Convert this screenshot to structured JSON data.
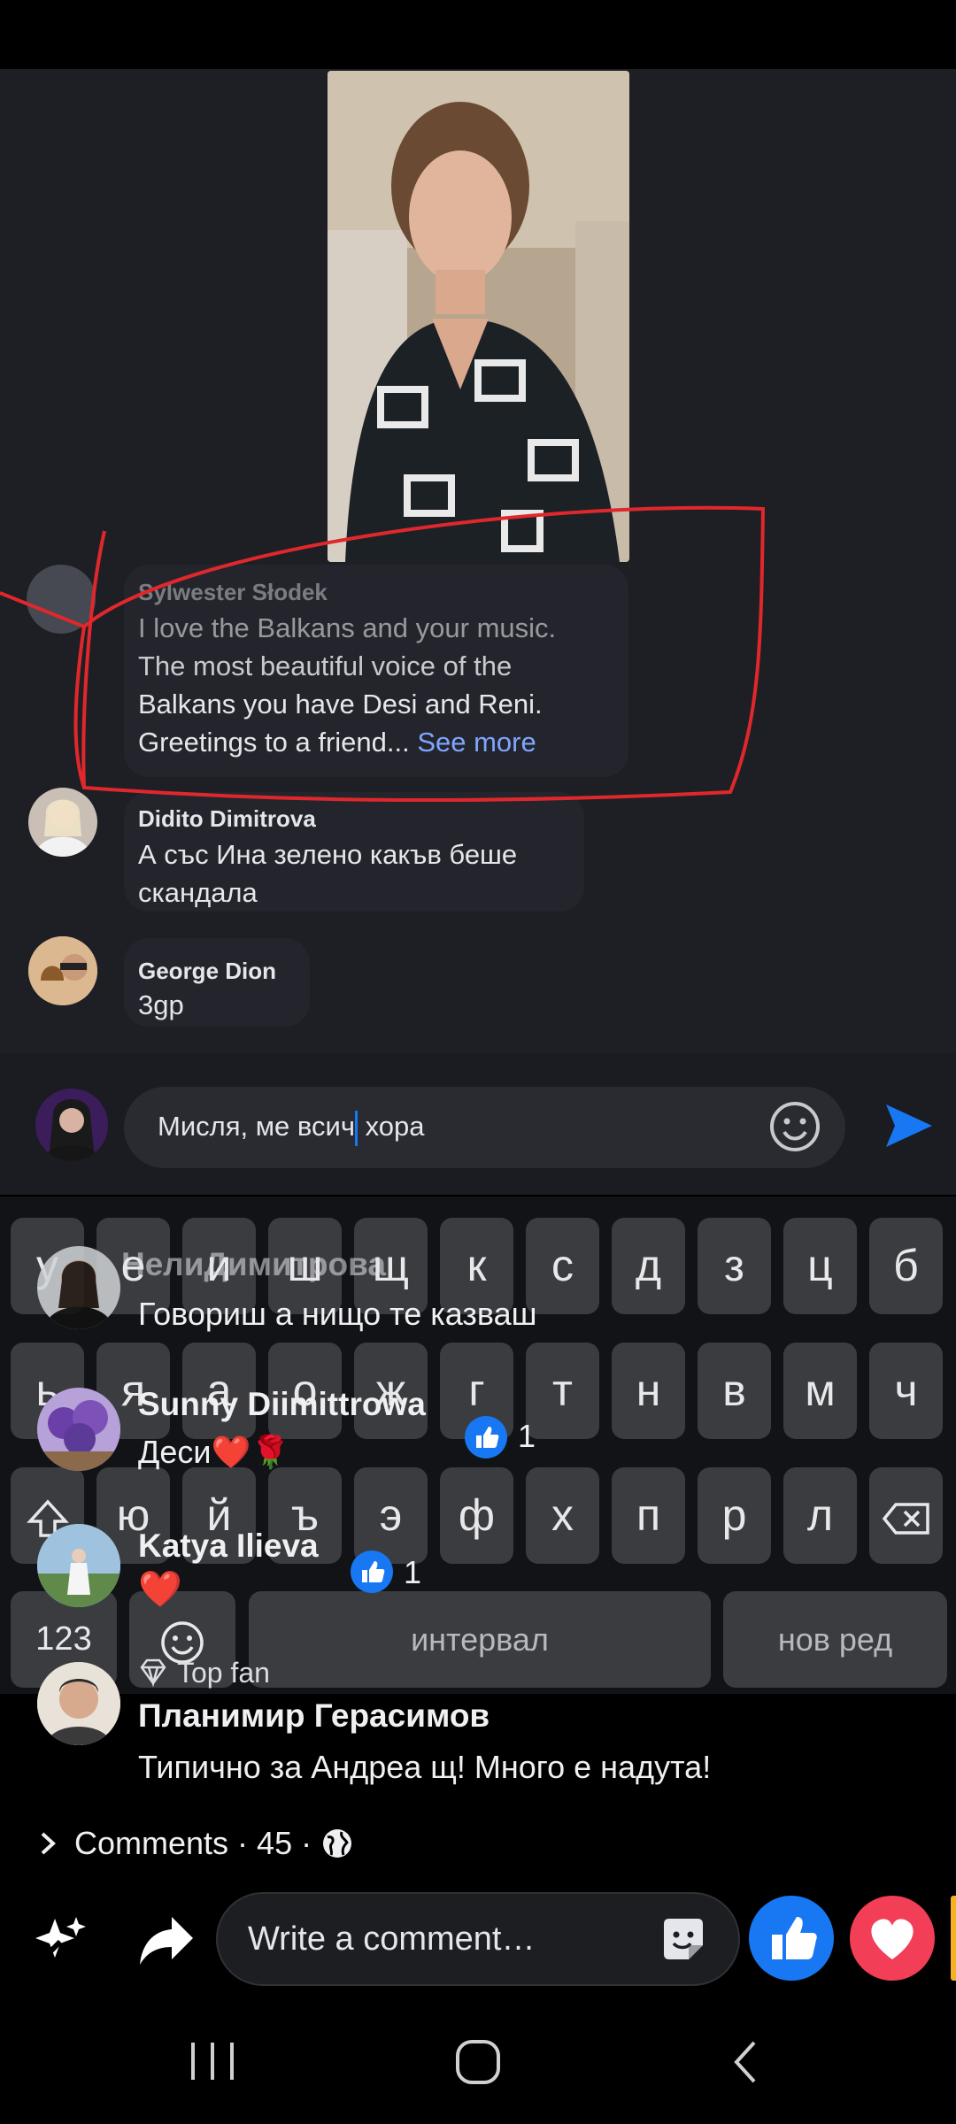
{
  "video": {
    "alt": "Live video of woman singing"
  },
  "comments": [
    {
      "name": "Sylwester Słodek",
      "text_lines": [
        "I love the Balkans and your music.",
        "The most beautiful voice of the",
        "Balkans you have Desi and Reni.",
        "Greetings to a friend... "
      ],
      "see_more": "See more"
    },
    {
      "name": "Didito Dimitrova",
      "text_lines": [
        "А със Ина зелено какъв беше",
        "скандала"
      ]
    },
    {
      "name": "George Dion",
      "text_lines": [
        "3gp"
      ]
    }
  ],
  "composer": {
    "value_before_cursor": "Мисля, ме всич",
    "value_after_cursor": " хора"
  },
  "keyboard": {
    "row1": [
      "у",
      "е",
      "и",
      "ш",
      "щ",
      "к",
      "с",
      "д",
      "з",
      "ц",
      "б"
    ],
    "row2": [
      "ь",
      "я",
      "а",
      "о",
      "ж",
      "г",
      "т",
      "н",
      "в",
      "м",
      "ч"
    ],
    "row3": [
      "ю",
      "й",
      "ъ",
      "э",
      "ф",
      "х",
      "п",
      "р",
      "л"
    ],
    "num_label": "123",
    "space_label": "интервал",
    "enter_label": "нов ред"
  },
  "overlay_comments": [
    {
      "name": "НелиДимитрова",
      "text": "Говориш а нищо те казваш"
    },
    {
      "name": "Sunny Diimittrowa",
      "text": "Деси❤️🌹",
      "likes": "1"
    },
    {
      "name": "Katya Ilieva",
      "text": "❤️",
      "likes": "1"
    },
    {
      "badge": "Top fan",
      "name": "Планимир Герасимов",
      "text": "Типично за Андреа щ! Много е надута!"
    }
  ],
  "comments_summary": {
    "label": "Comments",
    "count": "45",
    "separator": " · "
  },
  "bottom_bar": {
    "placeholder": "Write a comment…"
  },
  "colors": {
    "accent": "#1877f2",
    "see_more": "#7fa5ff",
    "annotation": "#e0282c",
    "heart": "#f33e58"
  }
}
